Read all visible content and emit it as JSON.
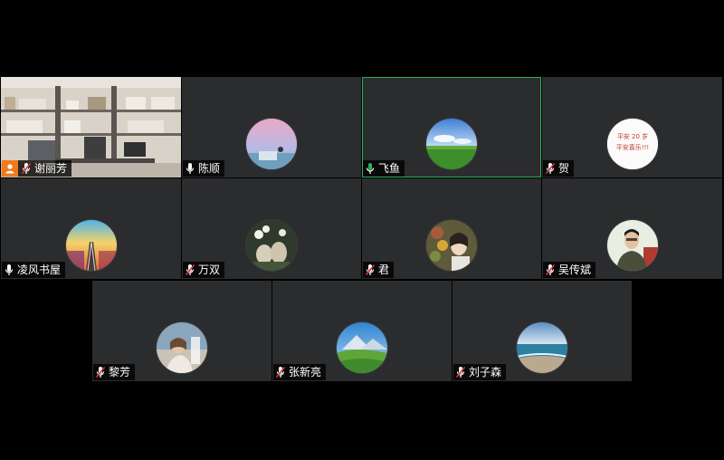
{
  "meeting": {
    "active_speaker": "飞鱼",
    "colors": {
      "background": "#000000",
      "tile": "#2b2c2e",
      "active_border": "#27b35a",
      "host_badge": "#f07a1a",
      "mic_on": "#ffffff",
      "mic_speaking": "#27b35a",
      "mic_muted_slash": "#d9323c"
    }
  },
  "participants": [
    {
      "name": "谢丽芳",
      "mic": "muted",
      "host": true,
      "video": true,
      "avatar": "office-bookshelf-video"
    },
    {
      "name": "陈顺",
      "mic": "on",
      "host": false,
      "video": false,
      "avatar": "pink-sky-avatar"
    },
    {
      "name": "飞鱼",
      "mic": "speaking",
      "host": false,
      "video": false,
      "avatar": "green-field-avatar",
      "active": true
    },
    {
      "name": "贺",
      "mic": "muted",
      "host": false,
      "video": false,
      "avatar": "handwriting-avatar",
      "avatar_text": "平安 20 岁 平安喜乐!!!"
    },
    {
      "name": "凌风书屋",
      "mic": "on",
      "host": false,
      "video": false,
      "avatar": "railway-sunset-avatar"
    },
    {
      "name": "万双",
      "mic": "muted",
      "host": false,
      "video": false,
      "avatar": "dogs-flowers-avatar"
    },
    {
      "name": "君",
      "mic": "muted",
      "host": false,
      "video": false,
      "avatar": "girl-flowers-avatar"
    },
    {
      "name": "吴传斌",
      "mic": "muted",
      "host": false,
      "video": false,
      "avatar": "man-portrait-avatar"
    },
    {
      "name": "黎芳",
      "mic": "muted",
      "host": false,
      "video": false,
      "avatar": "woman-beach-avatar"
    },
    {
      "name": "张新亮",
      "mic": "muted",
      "host": false,
      "video": false,
      "avatar": "mountain-meadow-avatar"
    },
    {
      "name": "刘子森",
      "mic": "muted",
      "host": false,
      "video": false,
      "avatar": "sea-shore-avatar"
    }
  ]
}
